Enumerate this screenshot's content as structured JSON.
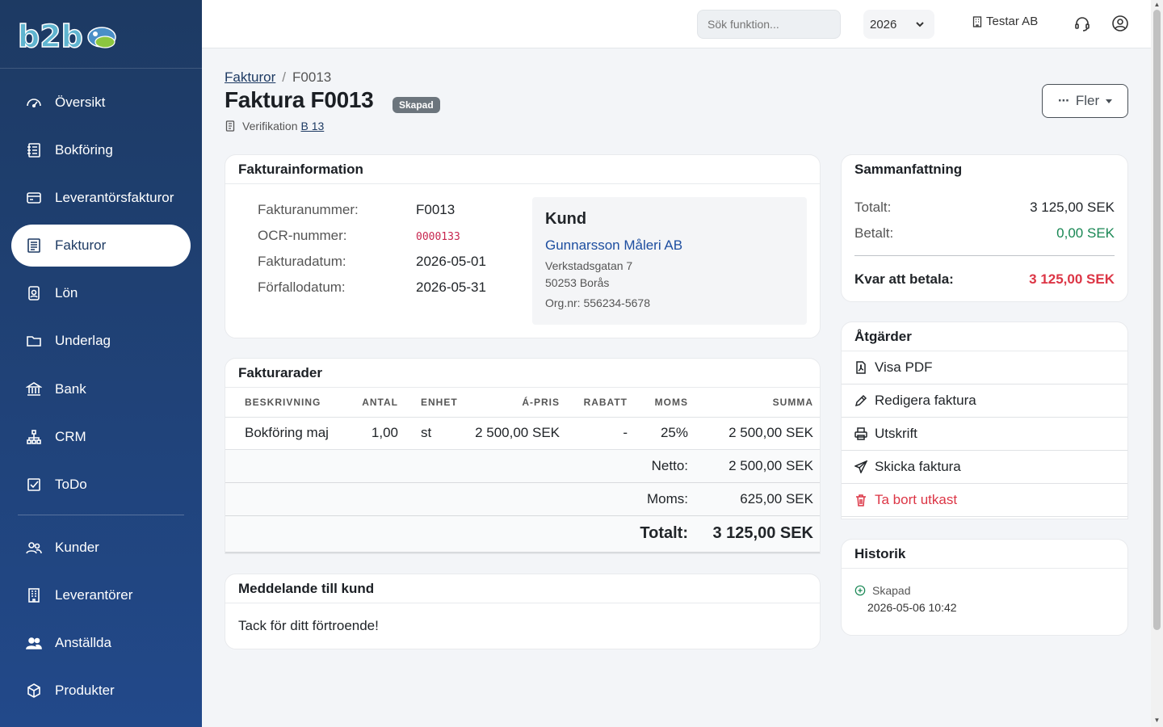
{
  "app": {
    "logo_text": "b2b"
  },
  "sidebar": {
    "items": [
      {
        "label": "Översikt",
        "icon": "speedometer-icon"
      },
      {
        "label": "Bokföring",
        "icon": "journal-icon"
      },
      {
        "label": "Leverantörsfakturor",
        "icon": "credit-card-icon"
      },
      {
        "label": "Fakturor",
        "icon": "invoice-icon",
        "active": true
      },
      {
        "label": "Lön",
        "icon": "person-badge-icon"
      },
      {
        "label": "Underlag",
        "icon": "folder-icon"
      },
      {
        "label": "Bank",
        "icon": "bank-icon"
      },
      {
        "label": "CRM",
        "icon": "diagram-icon"
      },
      {
        "label": "ToDo",
        "icon": "check-square-icon"
      },
      {
        "label": "Kunder",
        "icon": "people-icon"
      },
      {
        "label": "Leverantörer",
        "icon": "building-icon"
      },
      {
        "label": "Anställda",
        "icon": "people-fill-icon"
      },
      {
        "label": "Produkter",
        "icon": "box-icon"
      }
    ]
  },
  "topbar": {
    "search_placeholder": "Sök funktion...",
    "year": "2026",
    "company": "Testar AB"
  },
  "header": {
    "breadcrumb_link": "Fakturor",
    "breadcrumb_sep": "/",
    "breadcrumb_current": "F0013",
    "title": "Faktura F0013",
    "status_badge": "Skapad",
    "verification_label": "Verifikation",
    "verification_link": "B 13",
    "more_button": "Fler",
    "more_dots": "···"
  },
  "invoice_info": {
    "heading": "Fakturainformation",
    "fields": [
      {
        "label": "Fakturanummer:",
        "value": "F0013"
      },
      {
        "label": "OCR-nummer:",
        "value": "0000133"
      },
      {
        "label": "Fakturadatum:",
        "value": "2026-05-01"
      },
      {
        "label": "Förfallodatum:",
        "value": "2026-05-31"
      }
    ],
    "customer": {
      "heading": "Kund",
      "name": "Gunnarsson Måleri AB",
      "street": "Verkstadsgatan 7",
      "city": "50253 Borås",
      "org": "Org.nr: 556234-5678"
    }
  },
  "invoice_rows": {
    "heading": "Fakturarader",
    "columns": [
      "BESKRIVNING",
      "ANTAL",
      "ENHET",
      "Á-PRIS",
      "RABATT",
      "MOMS",
      "SUMMA"
    ],
    "rows": [
      {
        "desc": "Bokföring maj",
        "qty": "1,00",
        "unit": "st",
        "price": "2 500,00 SEK",
        "discount": "-",
        "vat": "25%",
        "sum": "2 500,00 SEK"
      }
    ],
    "netto_label": "Netto:",
    "netto_value": "2 500,00 SEK",
    "moms_label": "Moms:",
    "moms_value": "625,00 SEK",
    "total_label": "Totalt:",
    "total_value": "3 125,00 SEK"
  },
  "message": {
    "heading": "Meddelande till kund",
    "text": "Tack för ditt förtroende!"
  },
  "summary": {
    "heading": "Sammanfattning",
    "total_label": "Totalt:",
    "total_value": "3 125,00 SEK",
    "paid_label": "Betalt:",
    "paid_value": "0,00 SEK",
    "due_label": "Kvar att betala:",
    "due_value": "3 125,00 SEK"
  },
  "actions": {
    "heading": "Åtgärder",
    "items": [
      {
        "label": "Visa PDF",
        "icon": "pdf-icon"
      },
      {
        "label": "Redigera faktura",
        "icon": "pencil-icon"
      },
      {
        "label": "Utskrift",
        "icon": "printer-icon"
      },
      {
        "label": "Skicka faktura",
        "icon": "send-icon"
      },
      {
        "label": "Ta bort utkast",
        "icon": "trash-icon"
      }
    ]
  },
  "history": {
    "heading": "Historik",
    "events": [
      {
        "label": "Skapad",
        "time": "2026-05-06 10:42",
        "icon": "plus-circle-icon"
      }
    ]
  },
  "colors": {
    "sidebar": "#1d3a63",
    "paid": "#198754",
    "due": "#dc3545",
    "link": "#1d4ea0"
  }
}
